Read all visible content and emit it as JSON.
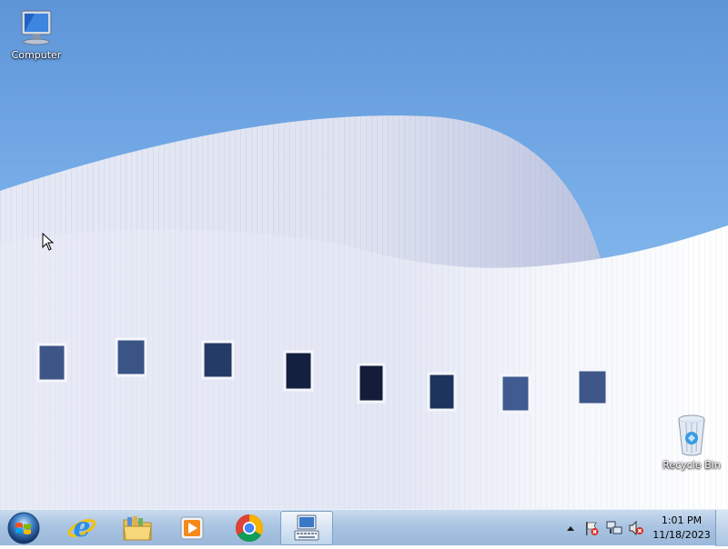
{
  "desktop": {
    "icons": [
      {
        "label": "Computer",
        "icon": "computer-icon"
      },
      {
        "label": "Recycle Bin",
        "icon": "recycle-bin-icon"
      }
    ]
  },
  "taskbar": {
    "start": {
      "icon": "windows-start-orb-icon"
    },
    "pinned": [
      {
        "name": "Internet Explorer",
        "icon": "internet-explorer-icon"
      },
      {
        "name": "Windows Explorer",
        "icon": "folder-libraries-icon"
      },
      {
        "name": "Windows Media Player",
        "icon": "media-player-icon"
      },
      {
        "name": "Google Chrome",
        "icon": "chrome-icon"
      },
      {
        "name": "On-Screen Keyboard",
        "icon": "keyboard-app-icon",
        "active": true
      }
    ],
    "tray": {
      "icons": [
        "show-hidden-icons-arrow",
        "action-center-flag-icon",
        "network-icon",
        "volume-muted-icon"
      ],
      "time": "1:01 PM",
      "date": "11/18/2023"
    }
  },
  "colors": {
    "taskbar": "#aac4e2",
    "sky": "#78aee8",
    "building": "#e9ecf6"
  }
}
